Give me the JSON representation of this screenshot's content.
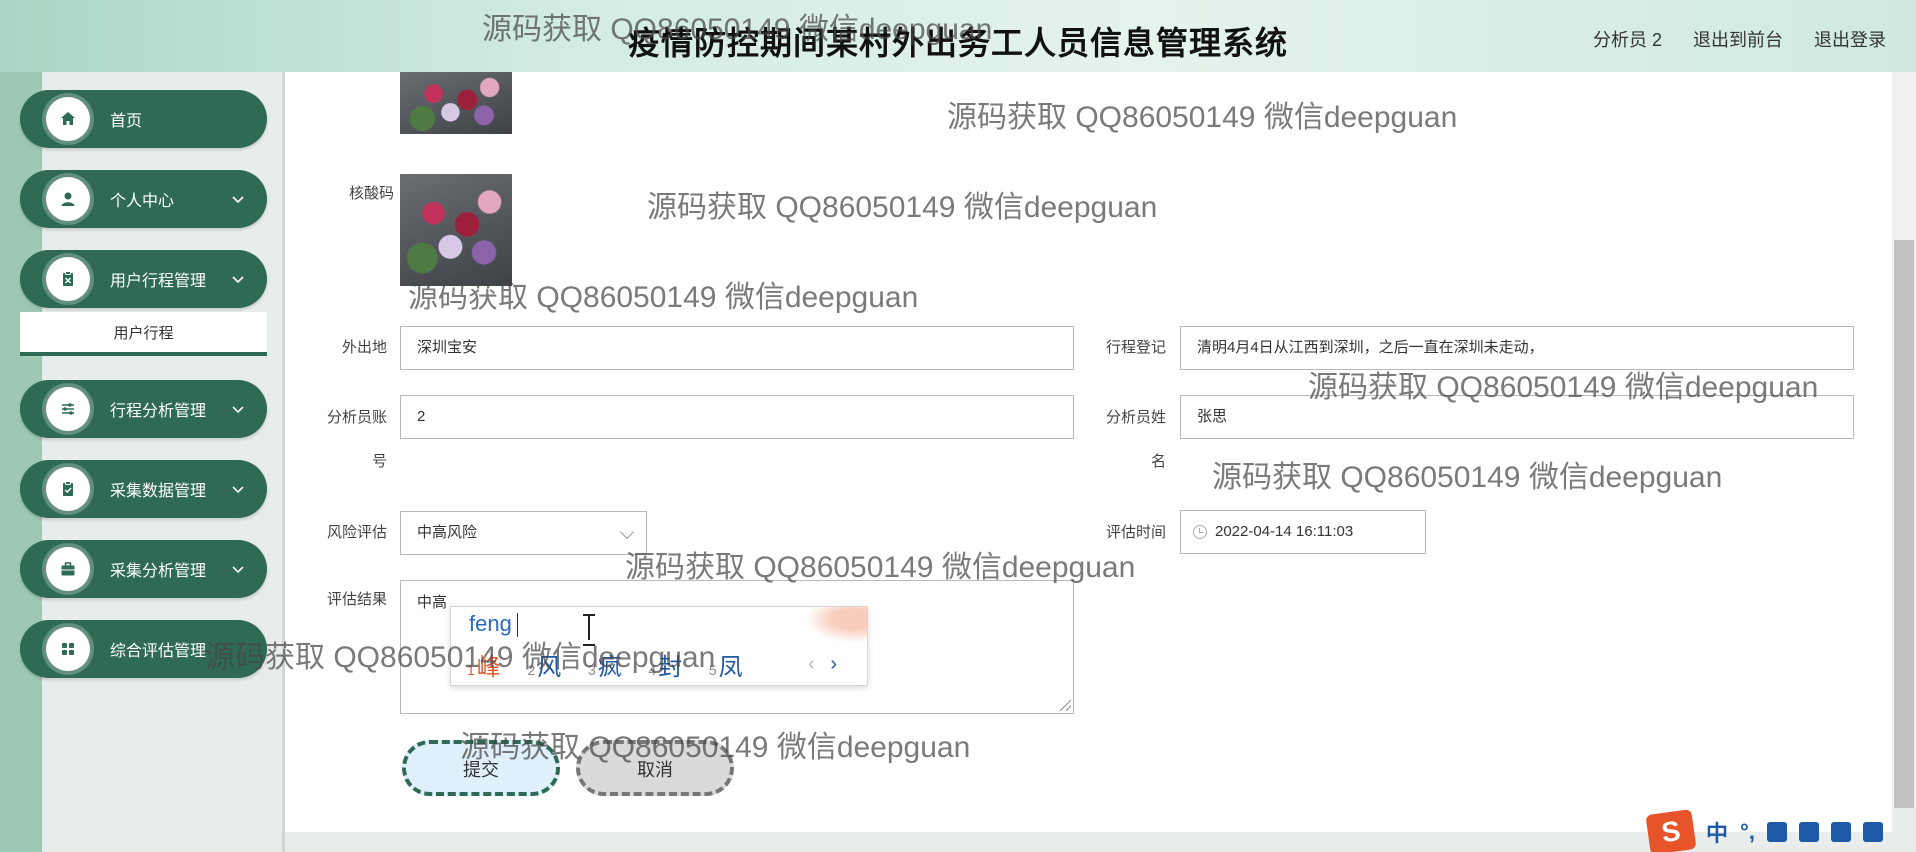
{
  "header": {
    "title": "疫情防控期间某村外出务工人员信息管理系统",
    "user_label": "分析员 2",
    "to_front_label": "退出到前台",
    "logout_label": "退出登录"
  },
  "sidebar": {
    "items": [
      {
        "label": "首页",
        "icon": "home-icon",
        "has_chevron": false
      },
      {
        "label": "个人中心",
        "icon": "user-icon",
        "has_chevron": true
      },
      {
        "label": "用户行程管理",
        "icon": "clipboard-icon",
        "has_chevron": true
      },
      {
        "label": "行程分析管理",
        "icon": "sliders-icon",
        "has_chevron": true
      },
      {
        "label": "采集数据管理",
        "icon": "clipboard-check-icon",
        "has_chevron": true
      },
      {
        "label": "采集分析管理",
        "icon": "briefcase-icon",
        "has_chevron": true
      },
      {
        "label": "综合评估管理",
        "icon": "grid-icon",
        "has_chevron": false
      }
    ],
    "submenu_label": "用户行程",
    "accent_color": "#2e6a54"
  },
  "form": {
    "nucleic_label": "核酸码",
    "destination_label": "外出地",
    "destination_value": "深圳宝安",
    "trip_log_label": "行程登记",
    "trip_log_value": "清明4月4日从江西到深圳，之后一直在深圳未走动，",
    "analyst_account_label_1": "分析员账",
    "analyst_account_label_2": "号",
    "analyst_account_value": "2",
    "analyst_name_label_1": "分析员姓",
    "analyst_name_label_2": "名",
    "analyst_name_value": "张思",
    "risk_label": "风险评估",
    "risk_value": "中高风险",
    "assess_time_label": "评估时间",
    "assess_time_value": "2022-04-14 16:11:03",
    "result_label": "评估结果",
    "result_value": "中高"
  },
  "ime": {
    "pinyin": "feng",
    "candidates": [
      {
        "n": "1",
        "c": "峰"
      },
      {
        "n": "2",
        "c": "风"
      },
      {
        "n": "3",
        "c": "疯"
      },
      {
        "n": "4",
        "c": "封"
      },
      {
        "n": "5",
        "c": "凤"
      }
    ],
    "prev": "‹",
    "next": "›"
  },
  "buttons": {
    "submit": "提交",
    "cancel": "取消"
  },
  "watermark": "源码获取 QQ86050149 微信deepguan",
  "tray": {
    "logo": "S",
    "lang": "中",
    "punct": "°,"
  }
}
